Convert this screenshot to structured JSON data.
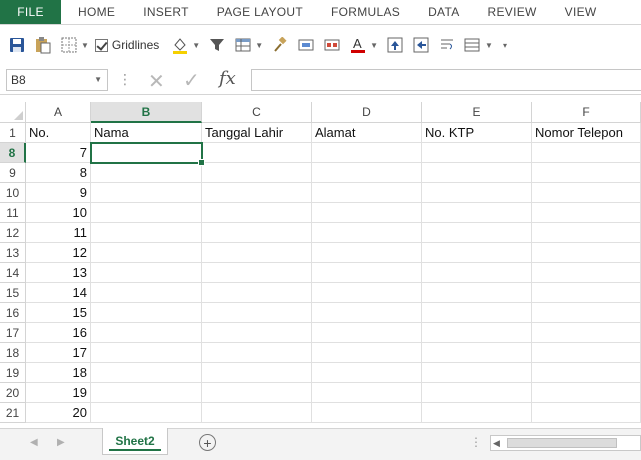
{
  "ribbon": {
    "tabs": [
      "FILE",
      "HOME",
      "INSERT",
      "PAGE LAYOUT",
      "FORMULAS",
      "DATA",
      "REVIEW",
      "VIEW"
    ]
  },
  "toolbar": {
    "gridlines_label": "Gridlines",
    "gridlines_checked": true,
    "icons": [
      "save-icon",
      "paste-icon",
      "borders-icon",
      "fill-color-icon",
      "filter-icon",
      "table-icon",
      "format-painter-icon",
      "merge-icon",
      "unmerge-icon",
      "font-color-icon",
      "upload-icon",
      "indent-icon",
      "wrap-icon",
      "sort-icon",
      "customize-icon"
    ],
    "accent_color": "#217346",
    "font_color_bar": "#d00000",
    "fill_color_bar": "#f5d000"
  },
  "formula_bar": {
    "name_box": "B8",
    "fx_label": "fx",
    "value": ""
  },
  "grid": {
    "columns": [
      "A",
      "B",
      "C",
      "D",
      "E",
      "F"
    ],
    "active_column": "B",
    "header_row": {
      "row_number": "1",
      "cells": [
        "No.",
        "Nama",
        "Tanggal Lahir",
        "Alamat",
        "No. KTP",
        "Nomor Telepon"
      ]
    },
    "rows": [
      {
        "row_number": "8",
        "a": "7"
      },
      {
        "row_number": "9",
        "a": "8"
      },
      {
        "row_number": "10",
        "a": "9"
      },
      {
        "row_number": "11",
        "a": "10"
      },
      {
        "row_number": "12",
        "a": "11"
      },
      {
        "row_number": "13",
        "a": "12"
      },
      {
        "row_number": "14",
        "a": "13"
      },
      {
        "row_number": "15",
        "a": "14"
      },
      {
        "row_number": "16",
        "a": "15"
      },
      {
        "row_number": "17",
        "a": "16"
      },
      {
        "row_number": "18",
        "a": "17"
      },
      {
        "row_number": "19",
        "a": "18"
      },
      {
        "row_number": "20",
        "a": "19"
      },
      {
        "row_number": "21",
        "a": "20"
      }
    ],
    "active_row": "8"
  },
  "sheets": {
    "active": "Sheet2"
  }
}
